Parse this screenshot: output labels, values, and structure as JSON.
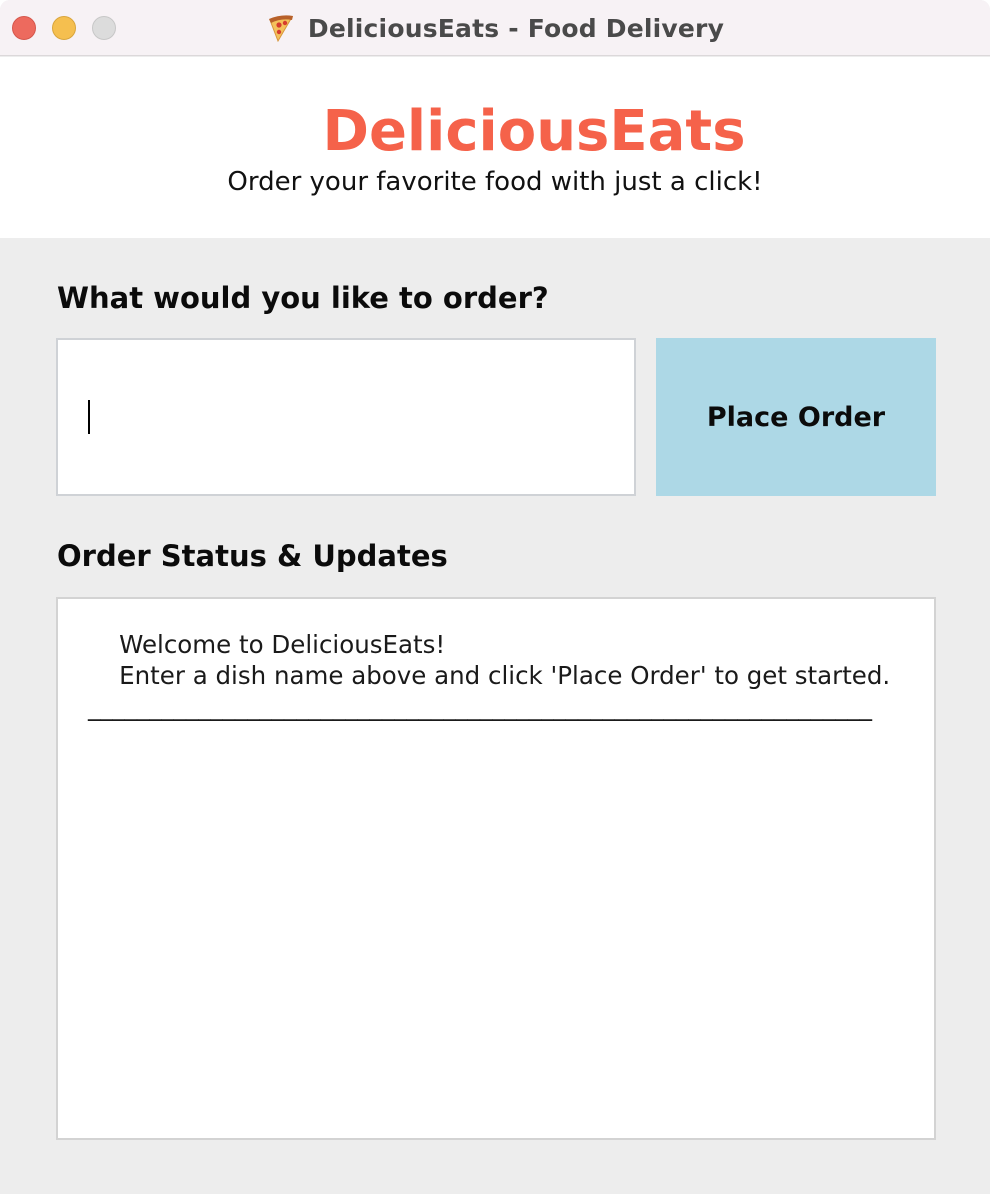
{
  "window": {
    "title": "DeliciousEats - Food Delivery",
    "title_icon": "pizza-icon"
  },
  "header": {
    "brand": "DeliciousEats",
    "tagline": "Order your favorite food with just a click!",
    "brand_color": "#f5624a"
  },
  "order": {
    "label": "What would you like to order?",
    "input_value": "",
    "button_label": "Place Order",
    "button_color": "#add8e6"
  },
  "status": {
    "label": "Order Status & Updates",
    "text": "    Welcome to DeliciousEats!\n    Enter a dish name above and click 'Place Order' to get started.\n________________________________________________________________"
  }
}
